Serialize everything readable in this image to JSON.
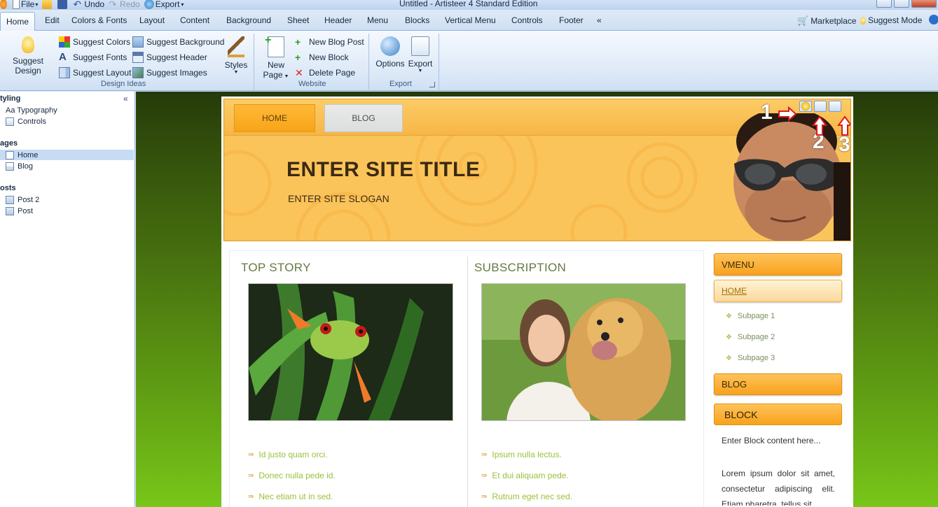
{
  "window": {
    "title": "Untitled - Artisteer 4 Standard Edition",
    "qat": [
      {
        "label": "File",
        "icon": "file-menu-icon"
      },
      {
        "label": "",
        "icon": "open-folder-icon"
      },
      {
        "label": "",
        "icon": "save-icon"
      },
      {
        "label": "Undo",
        "icon": "undo-icon"
      },
      {
        "label": "Redo",
        "icon": "redo-icon"
      },
      {
        "label": "Export",
        "icon": "export-icon"
      }
    ]
  },
  "ribbon": {
    "tabs": [
      "Home",
      "Edit",
      "Colors & Fonts",
      "Layout",
      "Content",
      "Background",
      "Sheet",
      "Header",
      "Menu",
      "Blocks",
      "Vertical Menu",
      "Controls",
      "Footer",
      "«"
    ],
    "active_tab": "Home",
    "marketplace": "Marketplace",
    "suggest_mode": "Suggest Mode",
    "design_ideas": {
      "label": "Design Ideas",
      "suggest_design": "Suggest Design",
      "suggest_colors": "Suggest Colors",
      "suggest_fonts": "Suggest Fonts",
      "suggest_layout": "Suggest Layout",
      "suggest_background": "Suggest Background",
      "suggest_header": "Suggest Header",
      "suggest_images": "Suggest Images",
      "styles": "Styles"
    },
    "website": {
      "label": "Website",
      "new_page_line1": "New",
      "new_page_line2": "Page",
      "new_blog_post": "New Blog Post",
      "new_block": "New Block",
      "delete_page": "Delete Page"
    },
    "export": {
      "label": "Export",
      "options": "Options",
      "export": "Export"
    }
  },
  "sidebar": {
    "collapse": "«",
    "styling_header": "tyling",
    "typography": "Aa Typography",
    "controls": "Controls",
    "pages_header": "ages",
    "home": "Home",
    "blog": "Blog",
    "posts_header": "osts",
    "post2": "Post 2",
    "post": "Post"
  },
  "site": {
    "nav_home": "HOME",
    "nav_blog": "BLOG",
    "title": "ENTER SITE TITLE",
    "slogan": "ENTER SITE SLOGAN",
    "annotations": [
      "1",
      "2",
      "3"
    ],
    "top_story": {
      "title": "TOP STORY",
      "items": [
        "Id justo quam orci.",
        "Donec nulla pede id.",
        "Nec etiam ut in sed."
      ]
    },
    "subscription": {
      "title": "SUBSCRIPTION",
      "items": [
        "Ipsum nulla lectus.",
        "Et dui aliquam pede.",
        "Rutrum eget nec sed."
      ]
    },
    "vmenu": {
      "title": "VMENU",
      "home": "HOME",
      "subpages": [
        "Subpage 1",
        "Subpage 2",
        "Subpage 3"
      ],
      "blog": "BLOG"
    },
    "block": {
      "title": "BLOCK",
      "line1": "Enter Block content here...",
      "lorem": "Lorem ipsum dolor sit amet, consectetur adipiscing elit. Etiam pharetra, tellus sit"
    }
  }
}
